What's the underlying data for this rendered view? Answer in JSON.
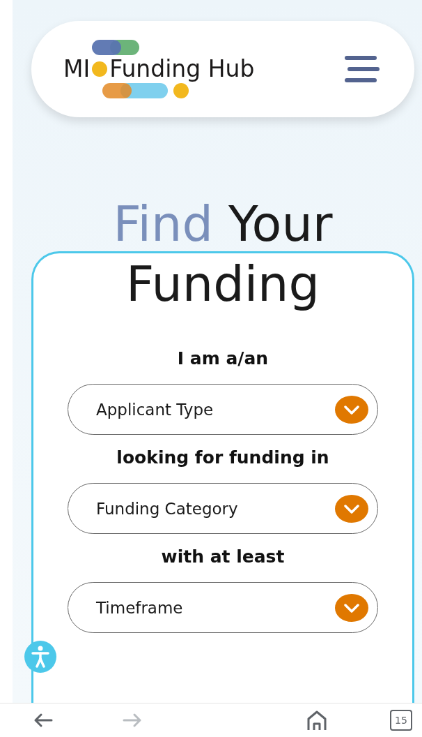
{
  "header": {
    "logo": {
      "left": "MI",
      "right": "Funding Hub"
    }
  },
  "hero": {
    "title_accent": "Find",
    "title_rest": "Your Funding"
  },
  "form": {
    "steps": [
      {
        "label": "I am a/an",
        "placeholder": "Applicant Type"
      },
      {
        "label": "looking for funding in",
        "placeholder": "Funding Category"
      },
      {
        "label": "with at least",
        "placeholder": "Timeframe"
      }
    ]
  },
  "browser_bar": {
    "back_disabled": false,
    "forward_disabled": true,
    "tab_count": "15"
  }
}
